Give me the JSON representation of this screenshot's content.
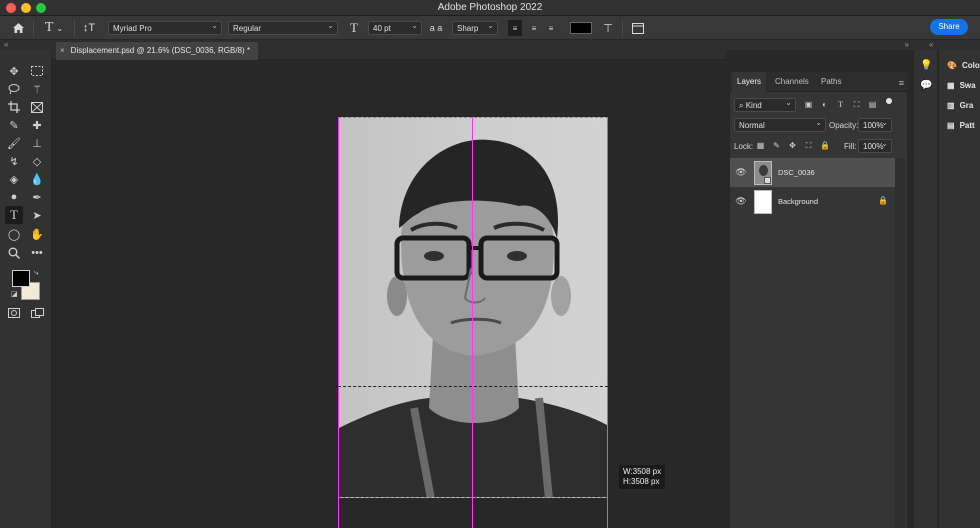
{
  "app": {
    "title": "Adobe Photoshop 2022"
  },
  "options": {
    "font_family": "Myriad Pro",
    "font_style": "Regular",
    "font_size": "40 pt",
    "aa_label": "a a",
    "antialias": "Sharp",
    "share_label": "Share",
    "text_color": "#000000"
  },
  "document": {
    "tab_title": "Displacement.psd @ 21.6% (DSC_0036, RGB/8) *",
    "close_glyph": "×"
  },
  "canvas": {
    "width_readout": "W:3508 px",
    "height_readout": "H:3508 px"
  },
  "panel": {
    "tabs": [
      "Layers",
      "Channels",
      "Paths"
    ],
    "kind_label": "Kind",
    "blend_mode": "Normal",
    "opacity_label": "Opacity:",
    "opacity_value": "100%",
    "lock_label": "Lock:",
    "fill_label": "Fill:",
    "fill_value": "100%"
  },
  "layers": [
    {
      "name": "DSC_0036",
      "selected": true,
      "locked": false
    },
    {
      "name": "Background",
      "selected": false,
      "locked": true
    }
  ],
  "dock": {
    "items": [
      {
        "label": "Colo",
        "icon": "color-wheel-icon"
      },
      {
        "label": "Swa",
        "icon": "swatches-icon"
      },
      {
        "label": "Gra",
        "icon": "gradient-icon"
      },
      {
        "label": "Patt",
        "icon": "patterns-icon"
      }
    ]
  },
  "colors": {
    "accent": "#1473e6",
    "guide": "#ff33ff",
    "foreground_swatch": "#000000",
    "background_swatch": "#f0ead6"
  }
}
